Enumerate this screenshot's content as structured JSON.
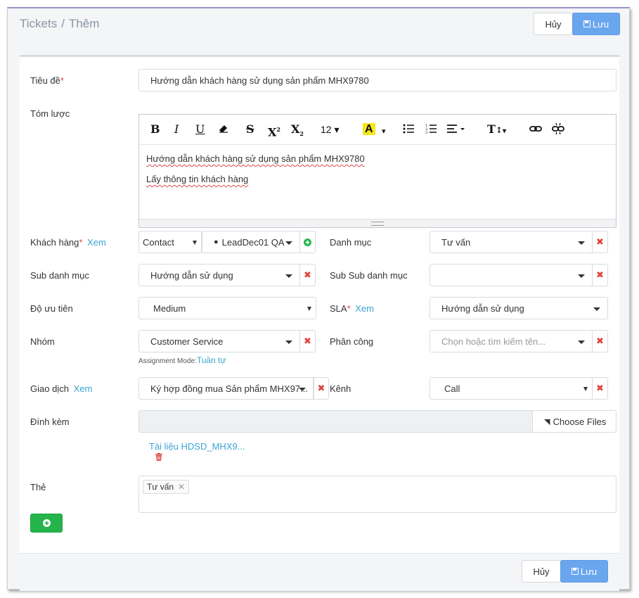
{
  "breadcrumb": {
    "root": "Tickets",
    "separator": "/",
    "current": "Thêm"
  },
  "header": {
    "cancel_label": "Hủy",
    "save_label": "Lưu"
  },
  "fields": {
    "title": {
      "label": "Tiêu đề",
      "value": "Hướng dẫn khách hàng sử dụng sản phẩm MHX9780"
    },
    "summary": {
      "label": "Tóm lược"
    },
    "customer": {
      "label": "Khách hàng",
      "link": "Xem",
      "type": "Contact",
      "value": "LeadDec01 QA"
    },
    "category": {
      "label": "Danh mục",
      "value": "Tư vấn"
    },
    "sub_category": {
      "label": "Sub danh mục",
      "value": "Hướng dẫn sử dụng"
    },
    "sub_sub_category": {
      "label": "Sub Sub danh mục",
      "value": ""
    },
    "priority": {
      "label": "Độ ưu tiên",
      "value": "Medium"
    },
    "sla": {
      "label": "SLA",
      "link": "Xem",
      "value": "Hướng dẫn sử dụng"
    },
    "group": {
      "label": "Nhóm",
      "value": "Customer Service",
      "mode_label": "Assignment Mode:",
      "mode_value": "Tuần tự"
    },
    "assignee": {
      "label": "Phân công",
      "placeholder": "Chọn hoặc tìm kiếm tên..."
    },
    "transaction": {
      "label": "Giao dịch",
      "link": "Xem",
      "value": "Ký hợp đồng mua Sản phẩm MHX97..."
    },
    "channel": {
      "label": "Kênh",
      "value": "Call"
    },
    "attachment": {
      "label": "Đính kèm",
      "button": "Choose Files",
      "file_name": "Tài liệu HDSD_MHX9..."
    },
    "tags": {
      "label": "Thẻ",
      "items": [
        "Tư vấn"
      ]
    }
  },
  "editor": {
    "font_size": "12",
    "lines": [
      "Hướng dẫn khách hàng sử dụng sản phẩm MHX9780",
      "Lấy thông tin khách hàng"
    ]
  },
  "footer": {
    "cancel_label": "Hủy",
    "save_label": "Lưu"
  },
  "colors": {
    "primary": "#6aa6ee",
    "success": "#25b34b",
    "danger": "#e0443a",
    "link": "#3aa4d3",
    "required": "#e04848"
  }
}
